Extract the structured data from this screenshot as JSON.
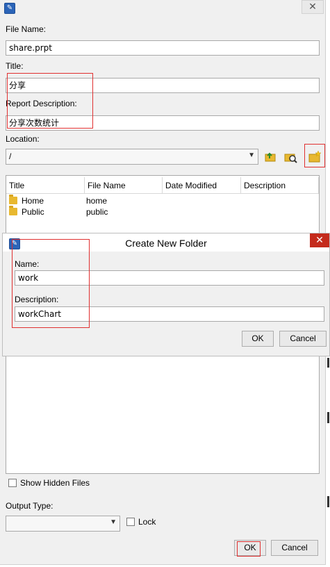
{
  "main": {
    "close_glyph": "✕",
    "file_name_label": "File Name:",
    "file_name_value": "share.prpt",
    "title_label": "Title:",
    "title_value": "分享",
    "report_description_label": "Report Description:",
    "report_description_value": "分享次数统计",
    "location_label": "Location:",
    "location_value": "/",
    "table": {
      "columns": [
        "Title",
        "File Name",
        "Date Modified",
        "Description"
      ],
      "rows": [
        {
          "title": "Home",
          "file_name": "home",
          "date_modified": "",
          "description": ""
        },
        {
          "title": "Public",
          "file_name": "public",
          "date_modified": "",
          "description": ""
        }
      ]
    },
    "show_hidden_files_label": "Show Hidden Files",
    "output_type_label": "Output Type:",
    "output_type_value": "",
    "lock_label": "Lock",
    "ok_label": "OK",
    "cancel_label": "Cancel"
  },
  "new_folder_dialog": {
    "title": "Create New Folder",
    "close_glyph": "✕",
    "name_label": "Name:",
    "name_value": "work",
    "description_label": "Description:",
    "description_value": "workChart",
    "ok_label": "OK",
    "cancel_label": "Cancel"
  },
  "icons": {
    "app_icon_glyph": "✎"
  },
  "colors": {
    "annotation_red": "#e03030",
    "close_red": "#c42b1c",
    "folder_yellow": "#e8b830",
    "app_icon_blue": "#2b64b8"
  }
}
